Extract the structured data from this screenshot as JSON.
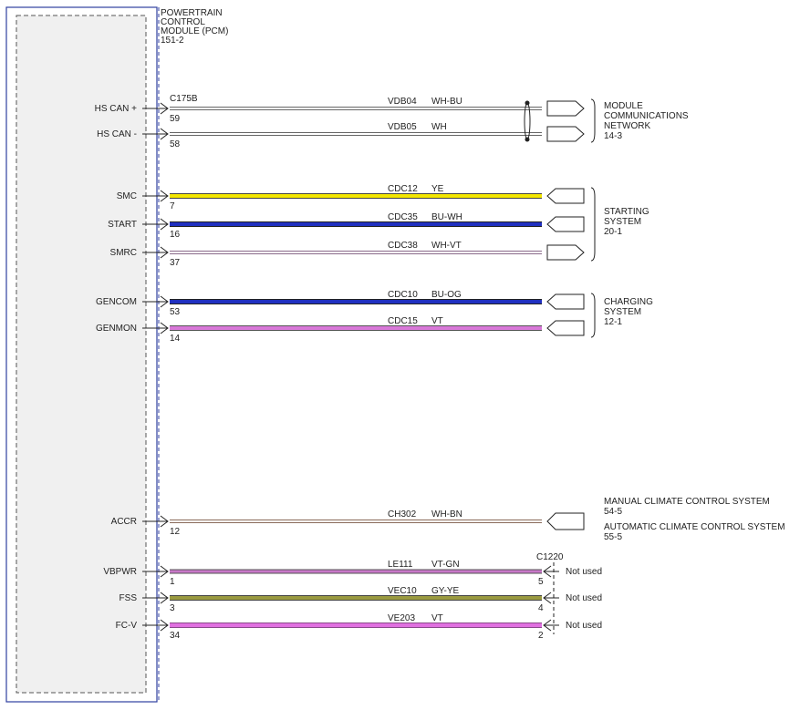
{
  "module": {
    "title_lines": [
      "POWERTRAIN",
      "CONTROL",
      "MODULE (PCM)",
      "151-2"
    ]
  },
  "connector_main": "C175B",
  "connector_right": "C1220",
  "wires": [
    {
      "pin_label": "HS CAN +",
      "pin": "59",
      "circuit": "VDB04",
      "color": "WH-BU",
      "stripe_main": "#ffffff",
      "stripe_trace": "#2030a0",
      "end": "right-arrow",
      "twisted": true
    },
    {
      "pin_label": "HS CAN -",
      "pin": "58",
      "circuit": "VDB05",
      "color": "WH",
      "stripe_main": "#ffffff",
      "stripe_trace": "#ffffff",
      "end": "right-arrow",
      "twisted": true
    },
    {
      "pin_label": "SMC",
      "pin": "7",
      "circuit": "CDC12",
      "color": "YE",
      "stripe_main": "#f3e600",
      "stripe_trace": "#f3e600",
      "end": "left-arrow"
    },
    {
      "pin_label": "START",
      "pin": "16",
      "circuit": "CDC35",
      "color": "BU-WH",
      "stripe_main": "#2030c0",
      "stripe_trace": "#ffffff",
      "end": "left-arrow"
    },
    {
      "pin_label": "SMRC",
      "pin": "37",
      "circuit": "CDC38",
      "color": "WH-VT",
      "stripe_main": "#ffffff",
      "stripe_trace": "#c080c0",
      "end": "right-arrow"
    },
    {
      "pin_label": "GENCOM",
      "pin": "53",
      "circuit": "CDC10",
      "color": "BU-OG",
      "stripe_main": "#2030c0",
      "stripe_trace": "#f08020",
      "end": "left-arrow"
    },
    {
      "pin_label": "GENMON",
      "pin": "14",
      "circuit": "CDC15",
      "color": "VT",
      "stripe_main": "#d878d8",
      "stripe_trace": "#d878d8",
      "end": "left-arrow"
    },
    {
      "pin_label": "ACCR",
      "pin": "12",
      "circuit": "CH302",
      "color": "WH-BN",
      "stripe_main": "#ffffff",
      "stripe_trace": "#a06040",
      "end": "left-arrow"
    },
    {
      "pin_label": "VBPWR",
      "pin": "1",
      "circuit": "LE111",
      "color": "VT-GN",
      "stripe_main": "#c878c8",
      "stripe_trace": "#60a040",
      "end": "not-used",
      "right_pin": "5",
      "note": "Not used"
    },
    {
      "pin_label": "FSS",
      "pin": "3",
      "circuit": "VEC10",
      "color": "GY-YE",
      "stripe_main": "#9a9a40",
      "stripe_trace": "#e8e040",
      "end": "not-used",
      "right_pin": "4",
      "note": "Not used"
    },
    {
      "pin_label": "FC-V",
      "pin": "34",
      "circuit": "VE203",
      "color": "VT",
      "stripe_main": "#e070e0",
      "stripe_trace": "#e070e0",
      "end": "not-used",
      "right_pin": "2",
      "note": "Not used"
    }
  ],
  "systems": [
    {
      "lines": [
        "MODULE",
        "COMMUNICATIONS",
        "NETWORK",
        "14-3"
      ]
    },
    {
      "lines": [
        "STARTING",
        "SYSTEM",
        "20-1"
      ]
    },
    {
      "lines": [
        "CHARGING",
        "SYSTEM",
        "12-1"
      ]
    },
    {
      "lines": [
        "MANUAL CLIMATE CONTROL SYSTEM",
        "54-5"
      ]
    },
    {
      "lines": [
        "AUTOMATIC CLIMATE CONTROL SYSTEM",
        "55-5"
      ]
    }
  ]
}
